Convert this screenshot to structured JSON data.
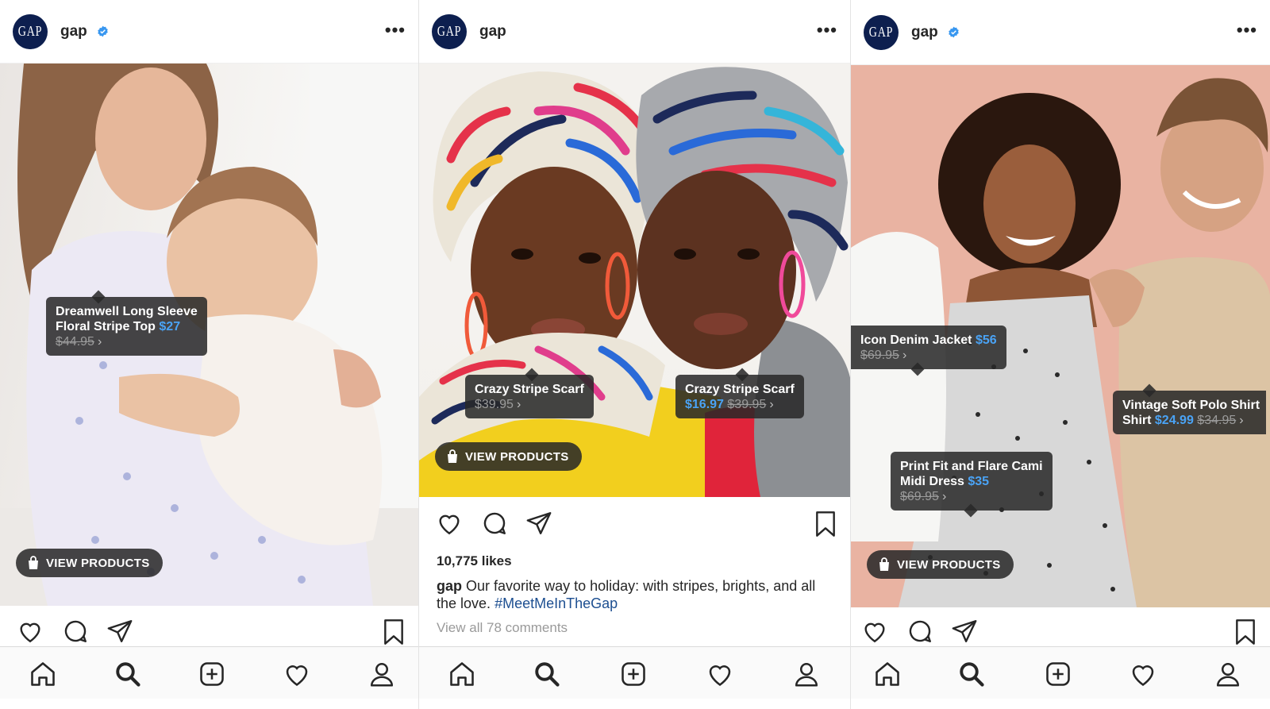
{
  "panels": [
    {
      "username": "gap",
      "verified": true,
      "avatar_text": "GAP",
      "tags": [
        {
          "name": "Dreamwell Long Sleeve Floral Stripe Top",
          "line1": "Dreamwell Long Sleeve",
          "line2": "Floral Stripe Top",
          "price": "$27",
          "old_price": "$44.95",
          "chevron": "›"
        }
      ],
      "view_products": "VIEW PRODUCTS"
    },
    {
      "username": "gap",
      "verified": false,
      "avatar_text": "GAP",
      "tags": [
        {
          "name": "Crazy Stripe Scarf",
          "price": "",
          "old_price": "$39.95",
          "chevron": "›",
          "old_is_struck": false
        },
        {
          "name": "Crazy Stripe Scarf",
          "price": "$16.97",
          "old_price": "$39.95",
          "chevron": "›"
        }
      ],
      "view_products": "VIEW PRODUCTS",
      "likes": "10,775 likes",
      "caption_user": "gap",
      "caption_text": "Our favorite way to holiday: with stripes, brights, and all the love.",
      "caption_hashtag": "#MeetMeInTheGap",
      "comments_link": "View all 78 comments"
    },
    {
      "username": "gap",
      "verified": true,
      "avatar_text": "GAP",
      "tags": [
        {
          "name": "Icon Denim Jacket",
          "price": "$56",
          "old_price": "$69.95",
          "chevron": "›"
        },
        {
          "line1": "Vintage Soft Polo Shirt",
          "line2": "Shirt",
          "price": "$24.99",
          "old_price": "$34.95",
          "chevron": "›"
        },
        {
          "line1": "Print Fit and Flare Cami",
          "line2": "Midi Dress",
          "price": "$35",
          "old_price": "$69.95",
          "chevron": "›"
        }
      ],
      "view_products": "VIEW PRODUCTS"
    }
  ],
  "icons": {
    "more": "•••",
    "like": "heart-icon",
    "comment": "comment-icon",
    "share": "paper-plane-icon",
    "save": "bookmark-icon",
    "tab_home": "home-icon",
    "tab_search": "search-icon",
    "tab_new": "add-post-icon",
    "tab_activity": "heart-icon",
    "tab_profile": "profile-icon"
  },
  "colors": {
    "price_blue": "#4aa3f5",
    "hashtag_blue": "#1d4f91",
    "verified_blue": "#3897f0",
    "gap_navy": "#0d1f4f",
    "tag_bg": "rgba(40,40,40,0.86)"
  }
}
